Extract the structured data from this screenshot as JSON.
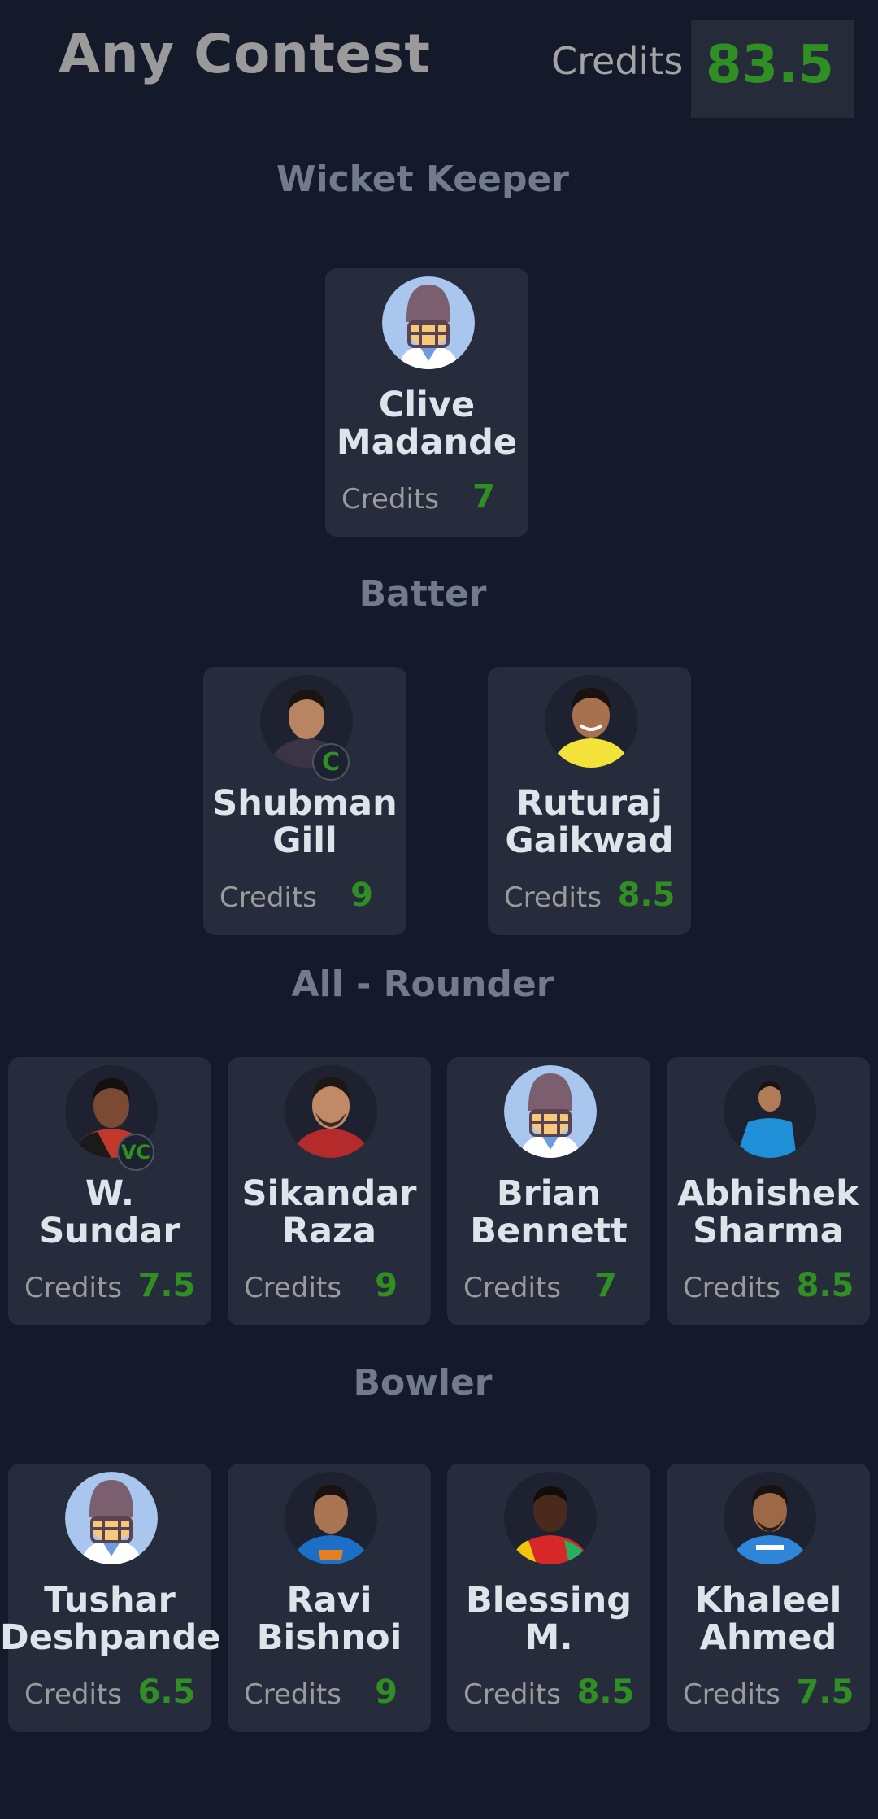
{
  "header": {
    "title": "Any Contest",
    "credits_label": "Credits",
    "credits_value": "83.5"
  },
  "sections": [
    {
      "title": "Wicket Keeper",
      "players": [
        {
          "name_line1": "Clive",
          "name_line2": "Madande",
          "credits_label": "Credits",
          "credits": "7",
          "avatar": "placeholder-helmet-icon",
          "badge": ""
        }
      ]
    },
    {
      "title": "Batter",
      "players": [
        {
          "name_line1": "Shubman",
          "name_line2": "Gill",
          "credits_label": "Credits",
          "credits": "9",
          "avatar": "player-photo",
          "badge": "C"
        },
        {
          "name_line1": "Ruturaj",
          "name_line2": "Gaikwad",
          "credits_label": "Credits",
          "credits": "8.5",
          "avatar": "player-photo",
          "badge": ""
        }
      ]
    },
    {
      "title": "All - Rounder",
      "players": [
        {
          "name_line1": "W.",
          "name_line2": "Sundar",
          "credits_label": "Credits",
          "credits": "7.5",
          "avatar": "player-photo",
          "badge": "VC"
        },
        {
          "name_line1": "Sikandar",
          "name_line2": "Raza",
          "credits_label": "Credits",
          "credits": "9",
          "avatar": "player-photo",
          "badge": ""
        },
        {
          "name_line1": "Brian",
          "name_line2": "Bennett",
          "credits_label": "Credits",
          "credits": "7",
          "avatar": "placeholder-helmet-icon",
          "badge": ""
        },
        {
          "name_line1": "Abhishek",
          "name_line2": "Sharma",
          "credits_label": "Credits",
          "credits": "8.5",
          "avatar": "player-photo",
          "badge": ""
        }
      ]
    },
    {
      "title": "Bowler",
      "players": [
        {
          "name_line1": "Tushar",
          "name_line2": "Deshpande",
          "credits_label": "Credits",
          "credits": "6.5",
          "avatar": "placeholder-helmet-icon",
          "badge": ""
        },
        {
          "name_line1": "Ravi",
          "name_line2": "Bishnoi",
          "credits_label": "Credits",
          "credits": "9",
          "avatar": "player-photo",
          "badge": ""
        },
        {
          "name_line1": "Blessing",
          "name_line2": "M.",
          "credits_label": "Credits",
          "credits": "8.5",
          "avatar": "player-photo",
          "badge": ""
        },
        {
          "name_line1": "Khaleel",
          "name_line2": "Ahmed",
          "credits_label": "Credits",
          "credits": "7.5",
          "avatar": "player-photo",
          "badge": ""
        }
      ]
    }
  ],
  "colors": {
    "background": "#141a2a",
    "card": "#272c3c",
    "accent_green": "#2f8f22",
    "section_title": "#737a8a"
  }
}
